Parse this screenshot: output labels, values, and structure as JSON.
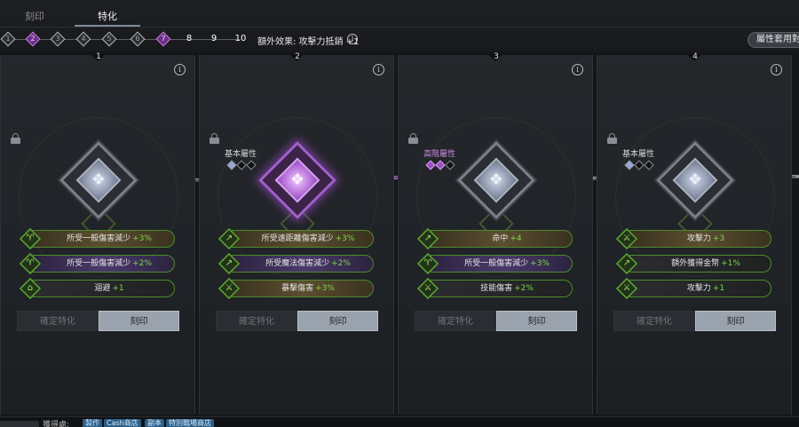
{
  "tabs": [
    {
      "label": "刻印"
    },
    {
      "label": "特化"
    }
  ],
  "steps": [
    "1",
    "2",
    "3",
    "4",
    "5",
    "6",
    "7",
    "8",
    "9",
    "10"
  ],
  "bonus_text": "額外效果: 攻擊力抵銷 +1",
  "info_glyph": "i",
  "apply_button": "屬性套用對象",
  "panels": [
    {
      "number": "1",
      "attr_label": "",
      "stats": [
        {
          "name": "所受一般傷害減少",
          "value": "+3%"
        },
        {
          "name": "所受一般傷害減少",
          "value": "+2%"
        },
        {
          "name": "迴避",
          "value": "+1"
        }
      ],
      "confirm": "確定特化",
      "engrave": "刻印"
    },
    {
      "number": "2",
      "attr_label": "基本屬性",
      "stats": [
        {
          "name": "所受遠距離傷害減少",
          "value": "+3%"
        },
        {
          "name": "所受魔法傷害減少",
          "value": "+2%"
        },
        {
          "name": "暴擊傷害",
          "value": "+3%"
        }
      ],
      "confirm": "確定特化",
      "engrave": "刻印"
    },
    {
      "number": "3",
      "attr_label": "高階屬性",
      "stats": [
        {
          "name": "命中",
          "value": "+4"
        },
        {
          "name": "所受一般傷害減少",
          "value": "+3%"
        },
        {
          "name": "技能傷害",
          "value": "+2%"
        }
      ],
      "confirm": "確定特化",
      "engrave": "刻印"
    },
    {
      "number": "4",
      "attr_label": "基本屬性",
      "stats": [
        {
          "name": "攻擊力",
          "value": "+3"
        },
        {
          "name": "額外獲得金幣",
          "value": "+1%"
        },
        {
          "name": "攻擊力",
          "value": "+1"
        }
      ],
      "confirm": "確定特化",
      "engrave": "刻印"
    }
  ],
  "bottom": {
    "label": "獲得處:",
    "chips": [
      "製作",
      "Cash商店",
      "副本",
      "特別戰場商店"
    ]
  }
}
